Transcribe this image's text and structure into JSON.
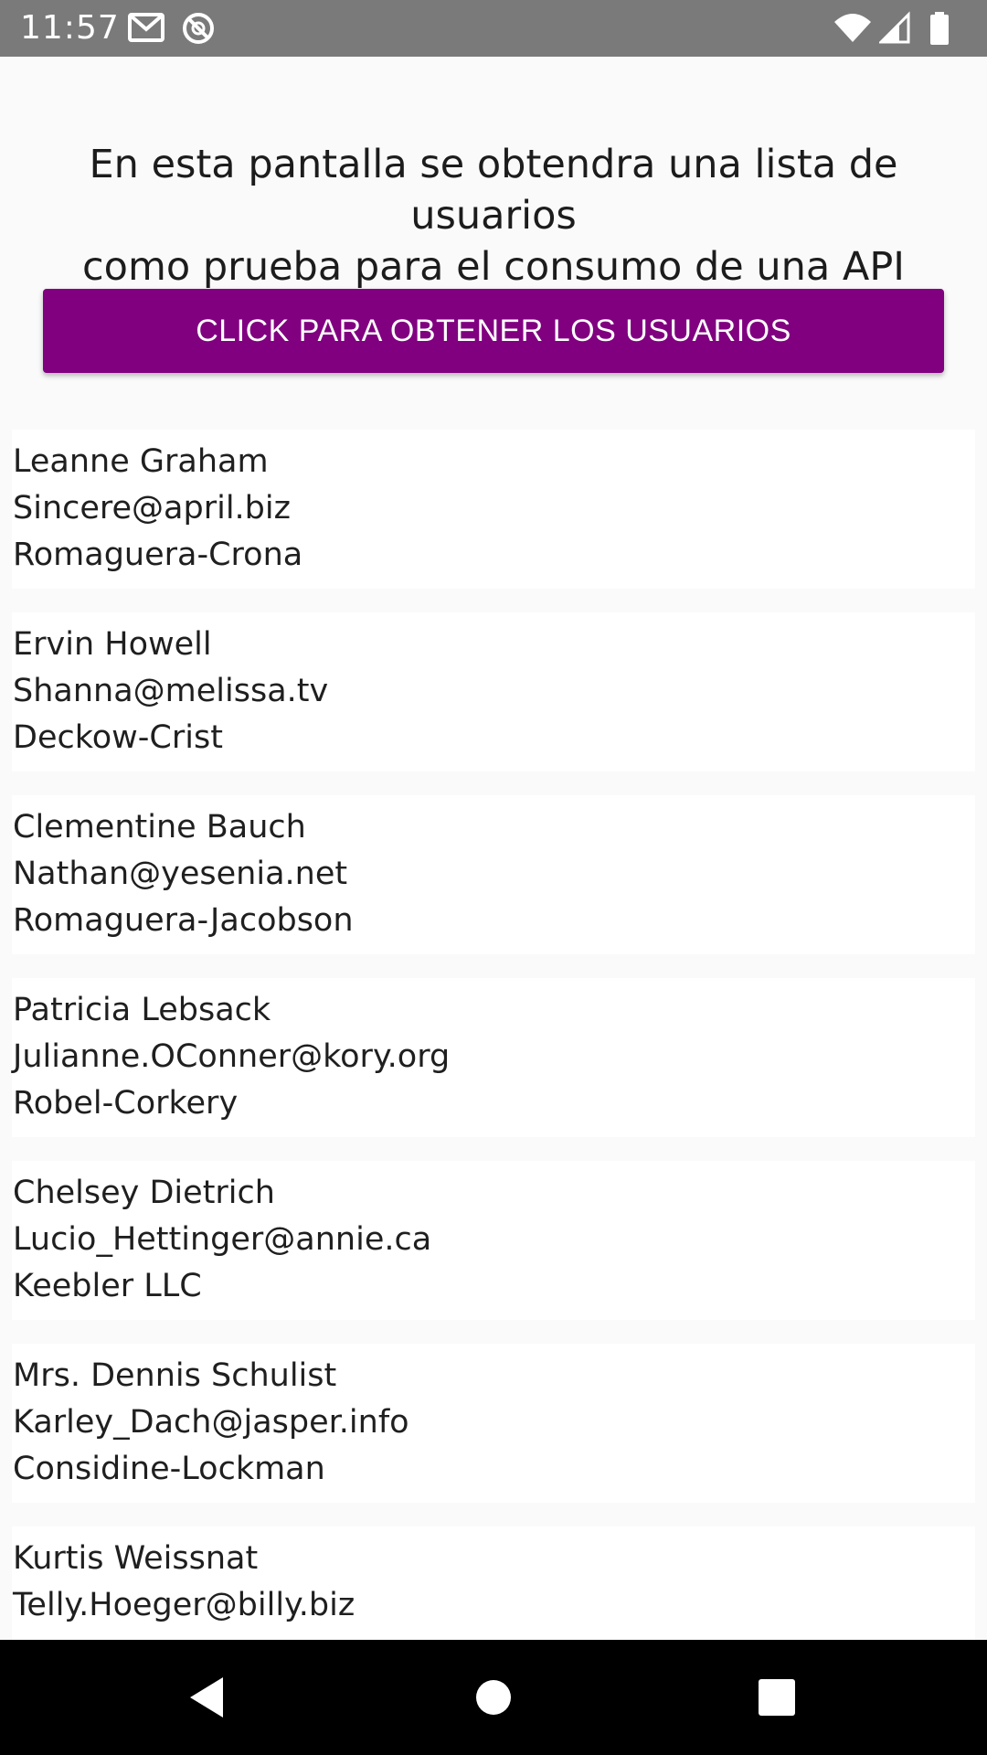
{
  "status_bar": {
    "time": "11:57",
    "left_icons": [
      "gmail-icon",
      "sync-disabled-icon"
    ],
    "right_icons": [
      "wifi-icon",
      "cell-signal-icon",
      "battery-icon"
    ]
  },
  "main": {
    "intro_text": "En esta pantalla se obtendra una lista de usuarios\ncomo prueba para el consumo de una API",
    "fetch_button_label": "CLICK PARA OBTENER LOS USUARIOS",
    "users": [
      {
        "name": "Leanne Graham",
        "email": "Sincere@april.biz",
        "company": "Romaguera-Crona"
      },
      {
        "name": "Ervin Howell",
        "email": "Shanna@melissa.tv",
        "company": "Deckow-Crist"
      },
      {
        "name": "Clementine Bauch",
        "email": "Nathan@yesenia.net",
        "company": "Romaguera-Jacobson"
      },
      {
        "name": "Patricia Lebsack",
        "email": "Julianne.OConner@kory.org",
        "company": "Robel-Corkery"
      },
      {
        "name": "Chelsey Dietrich",
        "email": "Lucio_Hettinger@annie.ca",
        "company": "Keebler LLC"
      },
      {
        "name": "Mrs. Dennis Schulist",
        "email": "Karley_Dach@jasper.info",
        "company": "Considine-Lockman"
      },
      {
        "name": "Kurtis Weissnat",
        "email": "Telly.Hoeger@billy.biz",
        "company": ""
      }
    ]
  },
  "colors": {
    "status_bar": "#7a7a7a",
    "button": "#800080",
    "background": "#fafafa",
    "card": "#ffffff",
    "nav_bar": "#000000"
  },
  "nav_bar": {
    "buttons": [
      "back-icon",
      "home-icon",
      "recents-icon"
    ]
  }
}
